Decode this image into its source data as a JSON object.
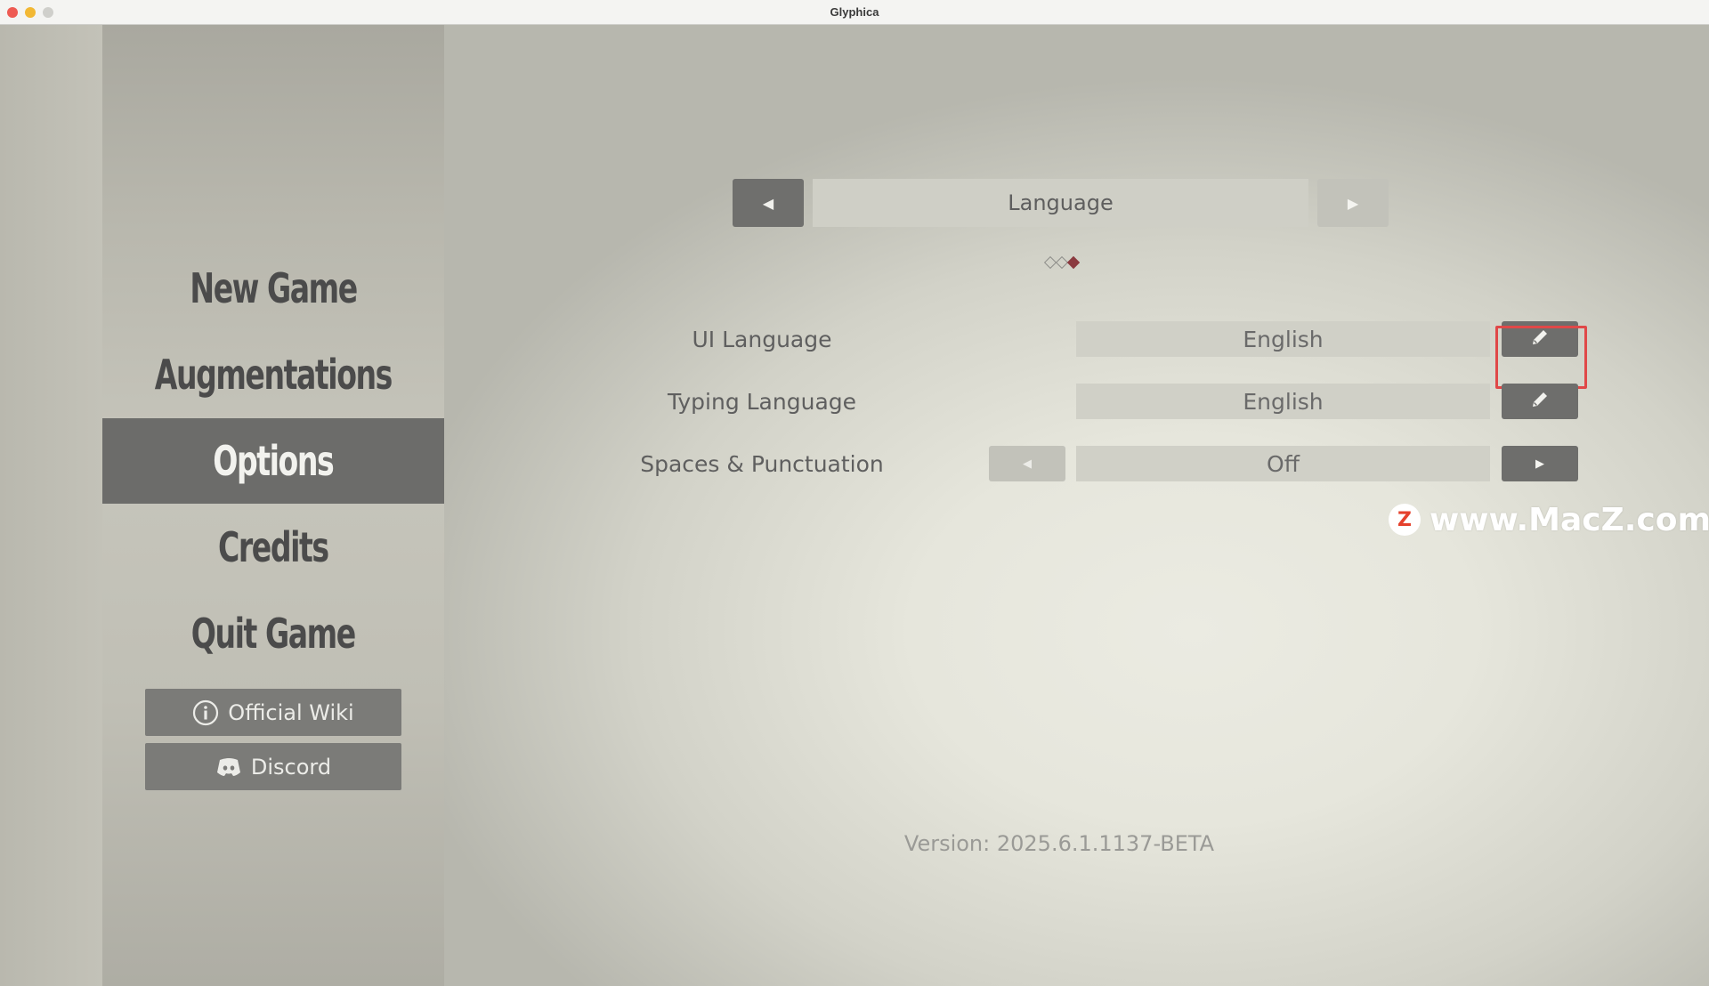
{
  "window": {
    "title": "Glyphica"
  },
  "menu": {
    "items": [
      {
        "label": "New Game"
      },
      {
        "label": "Augmentations"
      },
      {
        "label": "Options",
        "active": true
      },
      {
        "label": "Credits"
      },
      {
        "label": "Quit Game"
      }
    ],
    "wiki_label": "Official Wiki",
    "discord_label": "Discord"
  },
  "options": {
    "page_title": "Language",
    "pages_total": 3,
    "current_page": 3,
    "rows": [
      {
        "label": "UI Language",
        "value": "English",
        "control": "edit"
      },
      {
        "label": "Typing Language",
        "value": "English",
        "control": "edit"
      },
      {
        "label": "Spaces & Punctuation",
        "value": "Off",
        "control": "cycle"
      }
    ]
  },
  "version": "Version: 2025.6.1.1137-BETA",
  "watermark": {
    "logo": "Z",
    "text": "www.MacZ.com"
  },
  "colors": {
    "active_menu_bg": "#6c6c6a",
    "button_dark": "#6e6e6c",
    "highlight_border": "#e04848",
    "page_dot_active": "#8b3b40"
  },
  "icons": {
    "prev": "left-triangle",
    "next": "right-triangle",
    "edit": "pencil",
    "wiki": "info-circle",
    "discord": "discord-logo"
  }
}
